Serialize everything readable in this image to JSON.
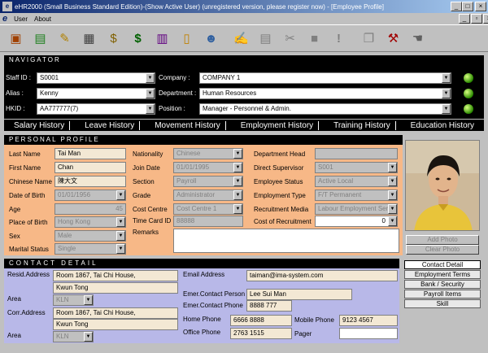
{
  "window": {
    "title": "eHR2000 (Small Business Standard Edition)-(Show Active User)  (unregistered version, please register now) - [Employee Profile]",
    "app_letter": "e"
  },
  "menu": {
    "items": [
      "User",
      "About"
    ]
  },
  "toolbar": {
    "icons": [
      "person-card-icon",
      "certificate-icon",
      "note-edit-icon",
      "calculator-icon",
      "money-bag-icon",
      "dollar-icon",
      "report-icon",
      "clipboard-icon",
      "people-icon",
      "pen-write-icon",
      "document-icon",
      "scissors-icon",
      "disk-icon",
      "alert-icon",
      "copy-icon",
      "tools-icon",
      "hand-icon"
    ]
  },
  "navigator": {
    "header": "NAVIGATOR",
    "staff_id": {
      "label": "Staff ID :",
      "value": "S0001"
    },
    "alias": {
      "label": "Alias :",
      "value": "Kenny"
    },
    "hkid": {
      "label": "HKID :",
      "value": "AA777777(7)"
    },
    "company": {
      "label": "Company :",
      "value": "COMPANY 1"
    },
    "department": {
      "label": "Department :",
      "value": "Human Resources"
    },
    "position": {
      "label": "Position :",
      "value": "Manager - Personnel & Admin."
    }
  },
  "tabs": [
    "Salary History",
    "Leave History",
    "Movement History",
    "Employment History",
    "Training History",
    "Education History"
  ],
  "personal": {
    "header": "PERSONAL PROFILE",
    "last_name": {
      "label": "Last Name",
      "value": "Tai Man"
    },
    "first_name": {
      "label": "First Name",
      "value": "Chan"
    },
    "chinese_name": {
      "label": "Chinese Name",
      "value": "陳大文"
    },
    "dob": {
      "label": "Date of Birth",
      "value": "01/01/1956"
    },
    "age": {
      "label": "Age",
      "value": "45"
    },
    "pob": {
      "label": "Place of Birth",
      "value": "Hong Kong"
    },
    "sex": {
      "label": "Sex",
      "value": "Male"
    },
    "marital": {
      "label": "Marital Status",
      "value": "Single"
    },
    "nationality": {
      "label": "Nationality",
      "value": "Chinese"
    },
    "join_date": {
      "label": "Join Date",
      "value": "01/01/1995"
    },
    "section": {
      "label": "Section",
      "value": "Payroll"
    },
    "grade": {
      "label": "Grade",
      "value": "Administrator"
    },
    "cost_centre": {
      "label": "Cost Centre",
      "value": "Cost Centre 1"
    },
    "time_card": {
      "label": "Time Card ID",
      "value": "88888"
    },
    "remarks": {
      "label": "Remarks",
      "value": ""
    },
    "dept_head": {
      "label": "Department Head",
      "value": ""
    },
    "direct_sup": {
      "label": "Direct Supervisor",
      "value": "S001"
    },
    "emp_status": {
      "label": "Employee Status",
      "value": "Active Local"
    },
    "emp_type": {
      "label": "Employment Type",
      "value": "F/T Permanent"
    },
    "rec_media": {
      "label": "Recruitment Media",
      "value": "Labour Employment Ser"
    },
    "cost_rec": {
      "label": "Cost of Recruitment",
      "value": "0"
    },
    "add_photo": "Add Photo",
    "clear_photo": "Clear Photo"
  },
  "contact": {
    "header": "CONTACT DETAIL",
    "resid_label": "Resid.Address",
    "resid1": "Room 1867, Tai Chi House,",
    "resid2": "Kwun Tong",
    "area_label": "Area",
    "area1": "KLN",
    "corr_label": "Corr.Address",
    "corr1": "Room 1867, Tai Chi House,",
    "corr2": "Kwun Tong",
    "area2": "KLN",
    "email": {
      "label": "Email Address",
      "value": "taiman@ima-system.com"
    },
    "emer_person": {
      "label": "Emer.Contact Person",
      "value": "Lee Sui Man"
    },
    "emer_phone": {
      "label": "Emer.Contact Phone",
      "value": "8888 777"
    },
    "home_phone": {
      "label": "Home Phone",
      "value": "6666 8888"
    },
    "office_phone": {
      "label": "Office Phone",
      "value": "2763 1515"
    },
    "mobile": {
      "label": "Mobile Phone",
      "value": "9123 4567"
    },
    "pager": {
      "label": "Pager",
      "value": ""
    }
  },
  "side_buttons": [
    "Contact Detail",
    "Employment Terms",
    "Bank / Security",
    "Payroll Items",
    "Skill"
  ]
}
